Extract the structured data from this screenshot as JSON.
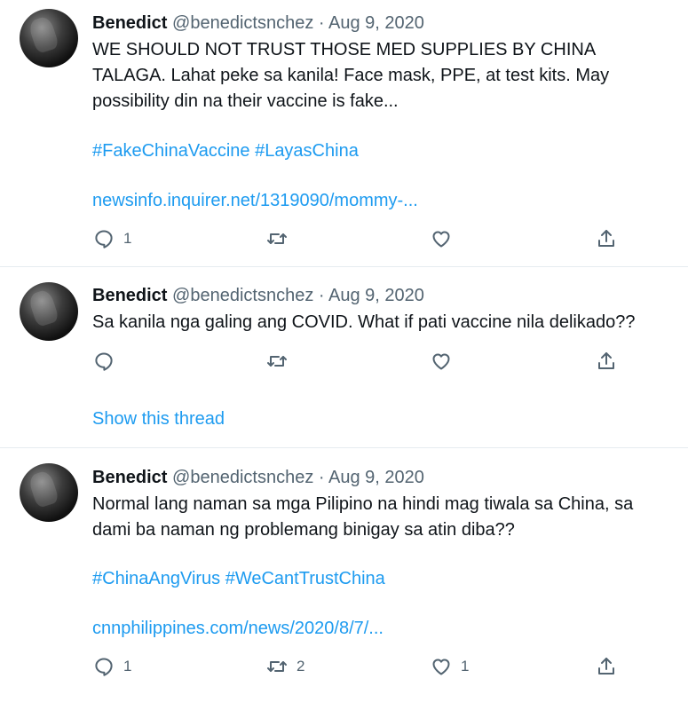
{
  "tweets": [
    {
      "author_name": "Benedict",
      "handle": "@benedictsnchez",
      "separator": "·",
      "date": "Aug 9, 2020",
      "text": "WE SHOULD NOT TRUST THOSE MED SUPPLIES BY CHINA\nTALAGA. Lahat peke sa kanila! Face mask, PPE, at test kits. May\npossibility din na their vaccine is fake...",
      "hashtags": "#FakeChinaVaccine #LayasChina",
      "link": "newsinfo.inquirer.net/1319090/mommy-...",
      "reply_count": "1",
      "retweet_count": "",
      "like_count": ""
    },
    {
      "author_name": "Benedict",
      "handle": "@benedictsnchez",
      "separator": "·",
      "date": "Aug 9, 2020",
      "text": "Sa kanila nga galing ang COVID. What if pati vaccine nila delikado??",
      "thread_link": "Show this thread",
      "reply_count": "",
      "retweet_count": "",
      "like_count": ""
    },
    {
      "author_name": "Benedict",
      "handle": "@benedictsnchez",
      "separator": "·",
      "date": "Aug 9, 2020",
      "text": "Normal lang naman sa mga Pilipino na hindi mag tiwala sa China, sa\ndami ba naman ng problemang binigay sa atin diba??",
      "hashtags": "#ChinaAngVirus #WeCantTrustChina",
      "link": "cnnphilippines.com/news/2020/8/7/...",
      "reply_count": "1",
      "retweet_count": "2",
      "like_count": "1"
    }
  ],
  "icons": {
    "reply": "reply-icon",
    "retweet": "retweet-icon",
    "like": "heart-icon",
    "share": "share-icon"
  },
  "colors": {
    "link": "#1d9bf0",
    "secondary_text": "#536471",
    "primary_text": "#0f1419",
    "divider": "#e6ecf0"
  }
}
